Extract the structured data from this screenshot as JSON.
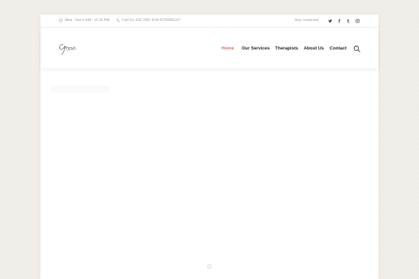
{
  "topbar": {
    "hours": "Mon - Sun 9 AM - 25 45 PM",
    "phone": "Call Us: 020 7602 4196  07393065257",
    "stay_connected": "Stay connected:",
    "social": [
      {
        "icon": "twitter-icon",
        "glyph": "𝕥"
      },
      {
        "icon": "facebook-icon",
        "glyph": "f"
      },
      {
        "icon": "tumblr-icon",
        "glyph": "t"
      },
      {
        "icon": "instagram-icon",
        "glyph": "◎"
      }
    ]
  },
  "header": {
    "logo": "signature-logo",
    "nav": [
      {
        "label": "Home",
        "active": true
      },
      {
        "label": "Our Services",
        "active": false
      },
      {
        "label": "Therapists",
        "active": false
      },
      {
        "label": "About Us",
        "active": false
      },
      {
        "label": "Contact",
        "active": false
      }
    ],
    "search_icon": "search-icon"
  },
  "colors": {
    "accent": "#e06a5f",
    "background": "#f1eeea",
    "text": "#222222",
    "muted": "#8a8a8a"
  }
}
